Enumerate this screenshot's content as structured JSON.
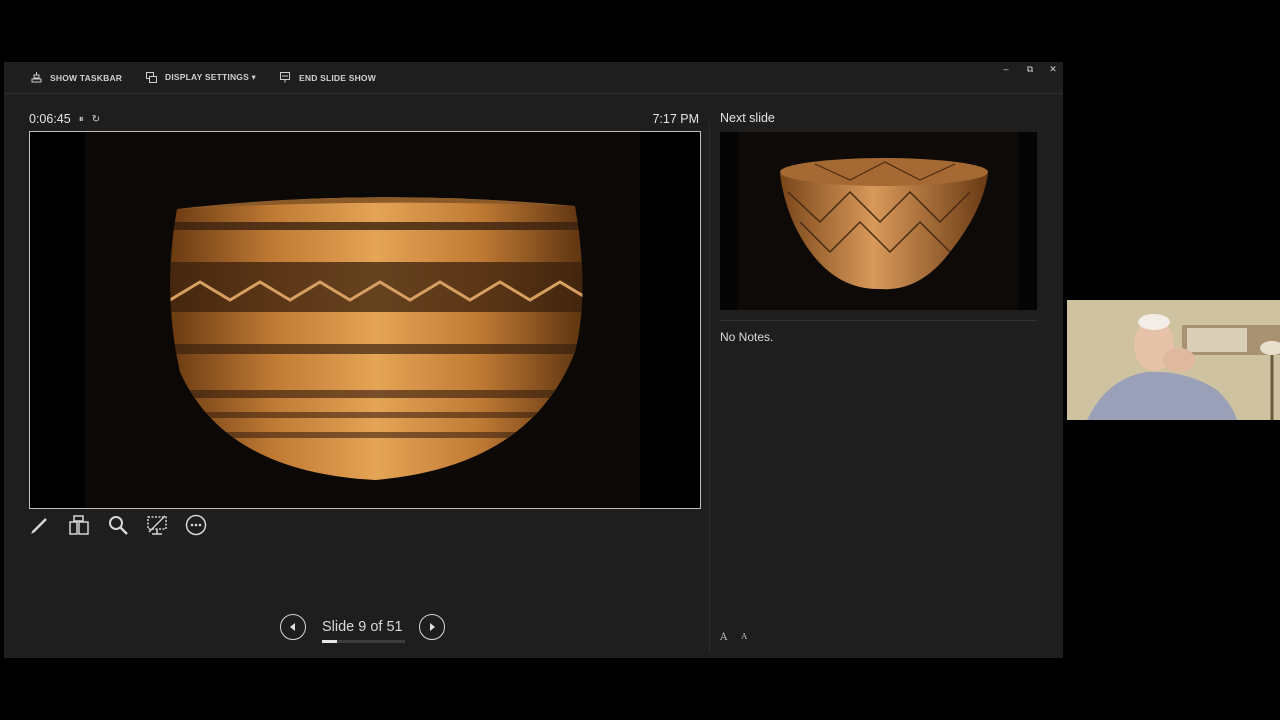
{
  "toolbar": {
    "show_taskbar": "SHOW TASKBAR",
    "display_settings": "DISPLAY SETTINGS ▾",
    "end_slide_show": "END SLIDE SHOW"
  },
  "window_controls": {
    "minimize": "–",
    "restore": "⧉",
    "close": "✕"
  },
  "timer": {
    "elapsed": "0:06:45",
    "pause": "⏸",
    "reset": "↻"
  },
  "clock": "7:17 PM",
  "next_slide_label": "Next slide",
  "notes": "No Notes.",
  "font_controls": {
    "increase": "A",
    "decrease": "A"
  },
  "navigation": {
    "slide_counter": "Slide 9 of 51",
    "current": 9,
    "total": 51
  },
  "tools": [
    "pen-icon",
    "see-all-slides-icon",
    "zoom-icon",
    "black-screen-icon",
    "more-options-icon"
  ]
}
